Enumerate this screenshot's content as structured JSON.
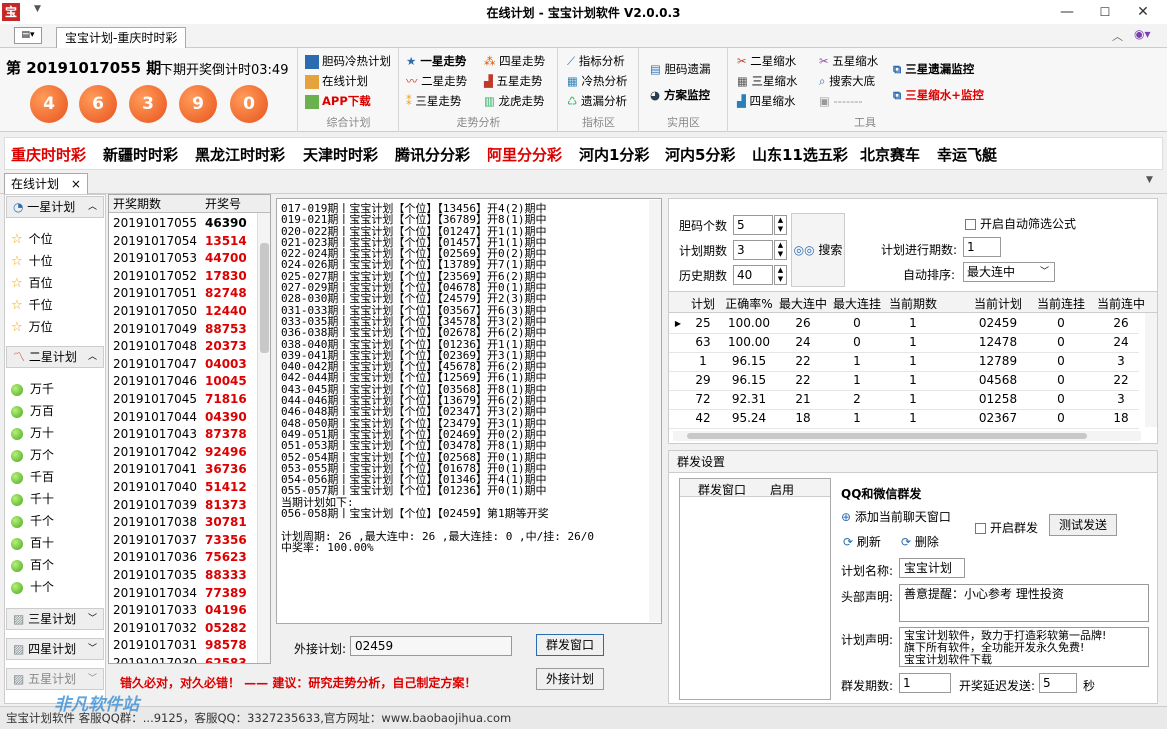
{
  "app": {
    "title": "在线计划 - 宝宝计划软件 V2.0.0.3",
    "logo_text": "宝",
    "menu_glyph": "▼"
  },
  "tabbar": {
    "doc_tab": "宝宝计划-重庆时时彩"
  },
  "ribbon": {
    "period": "第 20191017055 期",
    "countdown": "下期开奖倒计时03:49",
    "balls": [
      "4",
      "6",
      "3",
      "9",
      "0"
    ],
    "groups": {
      "g1": {
        "caption": "综合计划",
        "items": [
          "胆码冷热计划",
          "在线计划",
          "APP下载"
        ]
      },
      "g2": {
        "caption": "走势分析",
        "items": [
          "一星走势",
          "四星走势",
          "二星走势",
          "五星走势",
          "三星走势",
          "龙虎走势"
        ]
      },
      "g3": {
        "caption": "指标区",
        "items": [
          "指标分析",
          "冷热分析",
          "遗漏分析"
        ]
      },
      "g4": {
        "caption": "实用区",
        "items": [
          "胆码遗漏",
          "方案监控"
        ]
      },
      "g5": {
        "caption": "工具",
        "items": [
          "二星缩水",
          "五星缩水",
          "三星缩水",
          "搜索大底",
          "四星缩水",
          "-------",
          "三星遗漏监控",
          "三星缩水+监控"
        ]
      }
    }
  },
  "lotteries": [
    "重庆时时彩",
    "新疆时时彩",
    "黑龙江时时彩",
    "天津时时彩",
    "腾讯分分彩",
    "阿里分分彩",
    "河内1分彩",
    "河内5分彩",
    "山东11选五彩",
    "北京赛车",
    "幸运飞艇"
  ],
  "workspace_tab": {
    "label": "在线计划",
    "close": "×"
  },
  "sidebar": {
    "one_star": {
      "label": "一星计划",
      "items": [
        "个位",
        "十位",
        "百位",
        "千位",
        "万位"
      ]
    },
    "two_star": {
      "label": "二星计划",
      "items": [
        "万千",
        "万百",
        "万十",
        "万个",
        "千百",
        "千十",
        "千个",
        "百十",
        "百个",
        "十个"
      ]
    },
    "three_star": {
      "label": "三星计划"
    },
    "four_star": {
      "label": "四星计划"
    },
    "five_star": {
      "label": "五星计划"
    }
  },
  "history": {
    "headers": [
      "开奖期数",
      "开奖号"
    ],
    "rows": [
      [
        "20191017055",
        "46390"
      ],
      [
        "20191017054",
        "13514"
      ],
      [
        "20191017053",
        "44700"
      ],
      [
        "20191017052",
        "17830"
      ],
      [
        "20191017051",
        "82748"
      ],
      [
        "20191017050",
        "12440"
      ],
      [
        "20191017049",
        "88753"
      ],
      [
        "20191017048",
        "20373"
      ],
      [
        "20191017047",
        "04003"
      ],
      [
        "20191017046",
        "10045"
      ],
      [
        "20191017045",
        "71816"
      ],
      [
        "20191017044",
        "04390"
      ],
      [
        "20191017043",
        "87378"
      ],
      [
        "20191017042",
        "92496"
      ],
      [
        "20191017041",
        "36736"
      ],
      [
        "20191017040",
        "51412"
      ],
      [
        "20191017039",
        "81373"
      ],
      [
        "20191017038",
        "30781"
      ],
      [
        "20191017037",
        "73356"
      ],
      [
        "20191017036",
        "75623"
      ],
      [
        "20191017035",
        "88333"
      ],
      [
        "20191017034",
        "77389"
      ],
      [
        "20191017033",
        "04196"
      ],
      [
        "20191017032",
        "05282"
      ],
      [
        "20191017031",
        "98578"
      ],
      [
        "20191017030",
        "62583"
      ]
    ]
  },
  "log": {
    "lines": [
      "017-019期丨宝宝计划【个位】【13456】开4(2)期中",
      "019-021期丨宝宝计划【个位】【36789】开8(1)期中",
      "020-022期丨宝宝计划【个位】【01247】开1(1)期中",
      "021-023期丨宝宝计划【个位】【01457】开1(1)期中",
      "022-024期丨宝宝计划【个位】【02569】开0(2)期中",
      "024-026期丨宝宝计划【个位】【13789】开7(1)期中",
      "025-027期丨宝宝计划【个位】【23569】开6(2)期中",
      "027-029期丨宝宝计划【个位】【04678】开0(1)期中",
      "028-030期丨宝宝计划【个位】【24579】开2(3)期中",
      "031-033期丨宝宝计划【个位】【03567】开6(3)期中",
      "033-035期丨宝宝计划【个位】【34578】开3(2)期中",
      "036-038期丨宝宝计划【个位】【02678】开6(2)期中",
      "038-040期丨宝宝计划【个位】【01236】开1(1)期中",
      "039-041期丨宝宝计划【个位】【02369】开3(1)期中",
      "040-042期丨宝宝计划【个位】【45678】开6(2)期中",
      "042-044期丨宝宝计划【个位】【12569】开6(1)期中",
      "043-045期丨宝宝计划【个位】【03568】开8(1)期中",
      "044-046期丨宝宝计划【个位】【13679】开6(2)期中",
      "046-048期丨宝宝计划【个位】【02347】开3(2)期中",
      "048-050期丨宝宝计划【个位】【23479】开3(1)期中",
      "049-051期丨宝宝计划【个位】【02469】开0(2)期中",
      "051-053期丨宝宝计划【个位】【03478】开8(1)期中",
      "052-054期丨宝宝计划【个位】【02568】开0(1)期中",
      "053-055期丨宝宝计划【个位】【01678】开0(1)期中",
      "054-056期丨宝宝计划【个位】【01346】开4(1)期中",
      "055-057期丨宝宝计划【个位】【01236】开0(1)期中",
      "当期计划如下:",
      "056-058期丨宝宝计划【个位】【02459】第1期等开奖",
      "",
      "计划周期: 26 ,最大连中: 26 ,最大连挂: 0 ,中/挂: 26/0",
      "中奖率: 100.00%"
    ]
  },
  "external": {
    "label": "外接计划:",
    "value": "02459",
    "group_btn": "群发窗口",
    "ext_btn": "外接计划"
  },
  "slogan": "错久必对，对久必错！ —— 建议：研究走势分析，自己制定方案！",
  "search": {
    "code_count_label": "胆码个数",
    "code_count": "5",
    "plan_period_label": "计划期数",
    "plan_period": "3",
    "history_label": "历史期数",
    "history": "40",
    "search_btn": "搜索",
    "auto_filter": "开启自动筛选公式",
    "plan_progress_label": "计划进行期数:",
    "plan_progress": "1",
    "sort_label": "自动排序:",
    "sort_value": "最大连中"
  },
  "results": {
    "headers": [
      "计划",
      "正确率%",
      "最大连中",
      "最大连挂",
      "当前期数",
      "当前计划",
      "当前连挂",
      "当前连中"
    ],
    "rows": [
      [
        "25",
        "100.00",
        "26",
        "0",
        "1",
        "02459",
        "0",
        "26"
      ],
      [
        "63",
        "100.00",
        "24",
        "0",
        "1",
        "12478",
        "0",
        "24"
      ],
      [
        "1",
        "96.15",
        "22",
        "1",
        "1",
        "12789",
        "0",
        "3"
      ],
      [
        "29",
        "96.15",
        "22",
        "1",
        "1",
        "04568",
        "0",
        "22"
      ],
      [
        "72",
        "92.31",
        "21",
        "2",
        "1",
        "01258",
        "0",
        "3"
      ],
      [
        "42",
        "95.24",
        "18",
        "1",
        "1",
        "02367",
        "0",
        "18"
      ]
    ]
  },
  "group_send": {
    "panel_title": "群发设置",
    "col_window": "群发窗口",
    "col_enabled": "启用",
    "qq_title": "QQ和微信群发",
    "add_window": "添加当前聊天窗口",
    "enable_group": "开启群发",
    "test_send": "测试发送",
    "refresh": "刷新",
    "delete": "删除",
    "plan_name_label": "计划名称:",
    "plan_name": "宝宝计划",
    "header_label": "头部声明:",
    "header_text": "善意提醒：小心参考  理性投资",
    "plan_decl_label": "计划声明:",
    "plan_decl_lines": [
      "宝宝计划软件，致力于打造彩软第一品牌!",
      "旗下所有软件，全功能开发永久免费!",
      "宝宝计划软件下载"
    ],
    "group_period_label": "群发期数:",
    "group_period": "1",
    "delay_label": "开奖延迟发送:",
    "delay": "5",
    "delay_unit": "秒"
  },
  "statusbar": {
    "text": "宝宝计划软件 客服QQ群：...9125，客服QQ：3327235633,官方网址：www.baobaojihua.com",
    "watermark": "非凡软件站"
  },
  "colors": {
    "accent_red": "#dd0000",
    "ball_orange": "#e8521c"
  }
}
